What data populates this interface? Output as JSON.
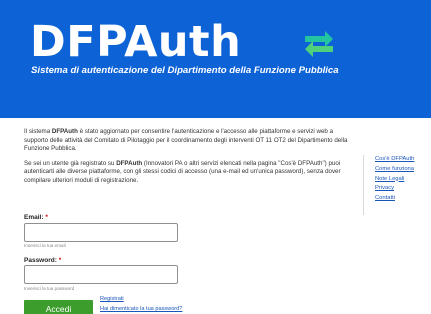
{
  "header": {
    "title": "DFPAuth",
    "subtitle": "Sistema di autenticazione del Dipartimento della Funzione Pubblica",
    "logo_colors": {
      "arrow_top": "#23c4a0",
      "arrow_bottom": "#4fd07a"
    },
    "background": "#0d63d6"
  },
  "intro": {
    "p1_a": "Il sistema ",
    "p1_b": "DFPAuth",
    "p1_c": " è stato aggiornato per consentire l'autenticazione e l'accesso alle piattaforme e servizi web a supporto delle attività del Comitato di Pilotaggio per il coordinamento degli interventi OT 11 OT2 del Dipartimento della Funzione Pubblica.",
    "p2_a": "Se sei un utente già registrato su ",
    "p2_b": "DFPAuth",
    "p2_c": " (Innovatori PA o altri servizi elencati nella pagina \"Cos'è DFPAuth\") puoi autenticarti alle diverse piattaforme, con gli stessi codici di accesso (una e-mail ed un'unica password), senza dover compilare ulteriori moduli di registrazione."
  },
  "form": {
    "email_label": "Email:",
    "email_hint": "Inserisci la tua email",
    "password_label": "Password:",
    "password_hint": "Inserisci la tua password",
    "required_mark": "*",
    "submit_label": "Accedi",
    "register_link": "Registrati",
    "forgot_link": "Hai dimenticato la tua password?"
  },
  "sidebar": {
    "links": [
      "Cos'è DFPAuth",
      "Come funziona",
      "Note Legali",
      "Privacy",
      "Contatti"
    ]
  }
}
